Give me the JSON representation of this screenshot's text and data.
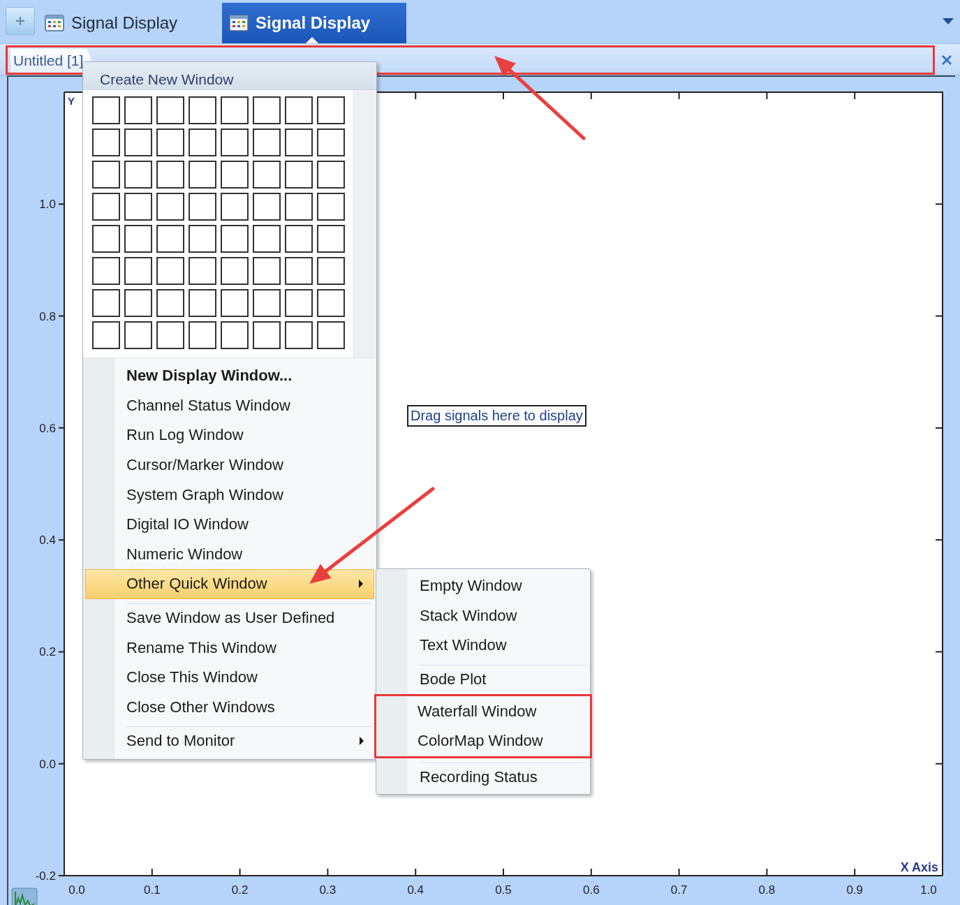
{
  "tabs": [
    {
      "label": "Signal Display",
      "selected": false
    },
    {
      "label": "Signal Display",
      "selected": true
    }
  ],
  "document_bar": {
    "highlighted": true,
    "tabs": [
      {
        "label": "Untitled [1]",
        "selected": true
      }
    ]
  },
  "context_menu": {
    "title": "Create New Window",
    "items": [
      {
        "label": "New Display Window...",
        "default": true,
        "selected": false,
        "has_submenu": false,
        "separator_before": false
      },
      {
        "label": "Channel Status Window",
        "default": false,
        "selected": false,
        "has_submenu": false,
        "separator_before": false
      },
      {
        "label": "Run Log Window",
        "default": false,
        "selected": false,
        "has_submenu": false,
        "separator_before": false
      },
      {
        "label": "Cursor/Marker Window",
        "default": false,
        "selected": false,
        "has_submenu": false,
        "separator_before": false
      },
      {
        "label": "System Graph Window",
        "default": false,
        "selected": false,
        "has_submenu": false,
        "separator_before": false
      },
      {
        "label": "Digital IO Window",
        "default": false,
        "selected": false,
        "has_submenu": false,
        "separator_before": false
      },
      {
        "label": "Numeric Window",
        "default": false,
        "selected": false,
        "has_submenu": false,
        "separator_before": false
      },
      {
        "label": "Other Quick Window",
        "default": false,
        "selected": true,
        "has_submenu": true,
        "separator_before": false
      },
      {
        "label": "Save Window as User Defined",
        "default": false,
        "selected": false,
        "has_submenu": false,
        "separator_before": true
      },
      {
        "label": "Rename This Window",
        "default": false,
        "selected": false,
        "has_submenu": false,
        "separator_before": false
      },
      {
        "label": "Close This Window",
        "default": false,
        "selected": false,
        "has_submenu": false,
        "separator_before": false
      },
      {
        "label": "Close Other Windows",
        "default": false,
        "selected": false,
        "has_submenu": false,
        "separator_before": false
      },
      {
        "label": "Send to Monitor",
        "default": false,
        "selected": false,
        "has_submenu": true,
        "separator_before": true
      }
    ]
  },
  "submenu": {
    "items": [
      {
        "label": "Empty Window",
        "separator_before": false,
        "highlighted": false
      },
      {
        "label": "Stack Window",
        "separator_before": false,
        "highlighted": false
      },
      {
        "label": "Text Window",
        "separator_before": false,
        "highlighted": false
      },
      {
        "label": "Bode Plot",
        "separator_before": true,
        "highlighted": false
      },
      {
        "label": "Waterfall Window",
        "separator_before": false,
        "highlighted": true
      },
      {
        "label": "ColorMap Window",
        "separator_before": false,
        "highlighted": true
      },
      {
        "label": "Recording Status",
        "separator_before": true,
        "highlighted": false
      }
    ]
  },
  "plot": {
    "drop_hint": "Drag signals here to display",
    "chart_data": {
      "type": "line",
      "xlabel": "X Axis",
      "ylabel": "Y",
      "xlim": [
        0,
        1
      ],
      "ylim": [
        -0.2,
        1.2
      ],
      "xticks": [
        {
          "value": 0,
          "label": "0.0"
        },
        {
          "value": 0.1,
          "label": "0.1"
        },
        {
          "value": 0.2,
          "label": "0.2"
        },
        {
          "value": 0.3,
          "label": "0.3"
        },
        {
          "value": 0.4,
          "label": "0.4"
        },
        {
          "value": 0.5,
          "label": "0.5"
        },
        {
          "value": 0.6,
          "label": "0.6"
        },
        {
          "value": 0.7,
          "label": "0.7"
        },
        {
          "value": 0.8,
          "label": "0.8"
        },
        {
          "value": 0.9,
          "label": "0.9"
        },
        {
          "value": 1,
          "label": "1.0"
        }
      ],
      "yticks": [
        {
          "value": -0.2,
          "label": "-0.2"
        },
        {
          "value": 0,
          "label": "0.0"
        },
        {
          "value": 0.2,
          "label": "0.2"
        },
        {
          "value": 0.4,
          "label": "0.4"
        },
        {
          "value": 0.6,
          "label": "0.6"
        },
        {
          "value": 0.8,
          "label": "0.8"
        },
        {
          "value": 1,
          "label": "1.0"
        }
      ]
    }
  },
  "annotations": [
    {
      "kind": "arrow"
    },
    {
      "kind": "arrow"
    }
  ]
}
